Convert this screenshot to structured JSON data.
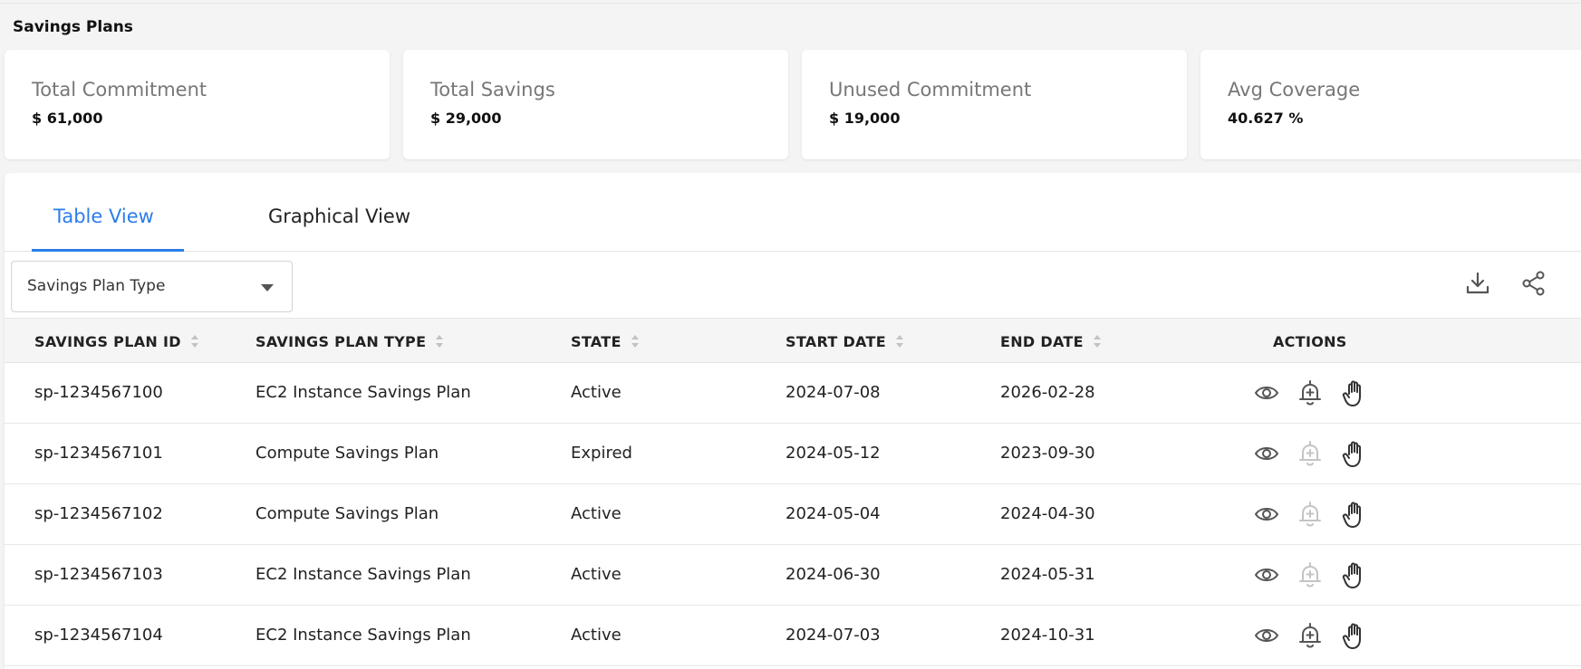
{
  "page": {
    "title": "Savings Plans"
  },
  "cards": [
    {
      "label": "Total Commitment",
      "value": "$ 61,000"
    },
    {
      "label": "Total Savings",
      "value": "$ 29,000"
    },
    {
      "label": "Unused Commitment",
      "value": "$ 19,000"
    },
    {
      "label": "Avg Coverage",
      "value": "40.627 %"
    }
  ],
  "tabs": [
    {
      "label": "Table View",
      "active": true
    },
    {
      "label": "Graphical View",
      "active": false
    }
  ],
  "filter": {
    "selected": "Savings Plan Type"
  },
  "toolbar": {
    "icons": [
      "download-icon",
      "share-icon"
    ]
  },
  "table": {
    "columns": [
      "SAVINGS PLAN ID",
      "SAVINGS PLAN TYPE",
      "STATE",
      "START DATE",
      "END DATE",
      "ACTIONS"
    ],
    "rows": [
      {
        "id": "sp-1234567100",
        "type": "EC2 Instance Savings Plan",
        "state": "Active",
        "start": "2024-07-08",
        "end": "2026-02-28",
        "alert_enabled": true
      },
      {
        "id": "sp-1234567101",
        "type": "Compute Savings Plan",
        "state": "Expired",
        "start": "2024-05-12",
        "end": "2023-09-30",
        "alert_enabled": false
      },
      {
        "id": "sp-1234567102",
        "type": "Compute Savings Plan",
        "state": "Active",
        "start": "2024-05-04",
        "end": "2024-04-30",
        "alert_enabled": false
      },
      {
        "id": "sp-1234567103",
        "type": "EC2 Instance Savings Plan",
        "state": "Active",
        "start": "2024-06-30",
        "end": "2024-05-31",
        "alert_enabled": false
      },
      {
        "id": "sp-1234567104",
        "type": "EC2 Instance Savings Plan",
        "state": "Active",
        "start": "2024-07-03",
        "end": "2024-10-31",
        "alert_enabled": true
      }
    ],
    "action_icons": [
      "eye-icon",
      "bell-plus-icon",
      "hand-icon"
    ]
  },
  "colors": {
    "accent": "#2b7de9",
    "icon": "#555555",
    "icon_disabled": "#c4c4c4"
  }
}
